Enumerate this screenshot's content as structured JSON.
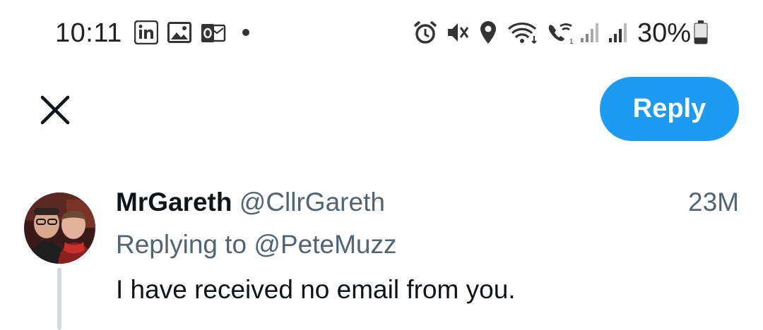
{
  "status_bar": {
    "time": "10:11",
    "battery_percent": "30%",
    "battery_level": 0.3,
    "notification_icons": [
      "linkedin-icon",
      "image-icon",
      "outlook-icon",
      "dot-icon"
    ],
    "system_icons": [
      "alarm-icon",
      "vibrate-mute-icon",
      "location-icon",
      "wifi-icon",
      "wifi-calling-icon",
      "signal-icon",
      "signal-icon",
      "battery-icon"
    ]
  },
  "top_bar": {
    "close_icon": "close-icon",
    "reply_label": "Reply"
  },
  "tweet": {
    "display_name": "MrGareth",
    "handle": "@CllrGareth",
    "timestamp": "23M",
    "replying_prefix": "Replying to",
    "replying_handle": "@PeteMuzz",
    "text": "I have received no email from you."
  },
  "colors": {
    "accent": "#1d9bf0",
    "secondary_text": "#536471",
    "primary_text": "#0f1419",
    "thread_line": "#cfd9de"
  }
}
